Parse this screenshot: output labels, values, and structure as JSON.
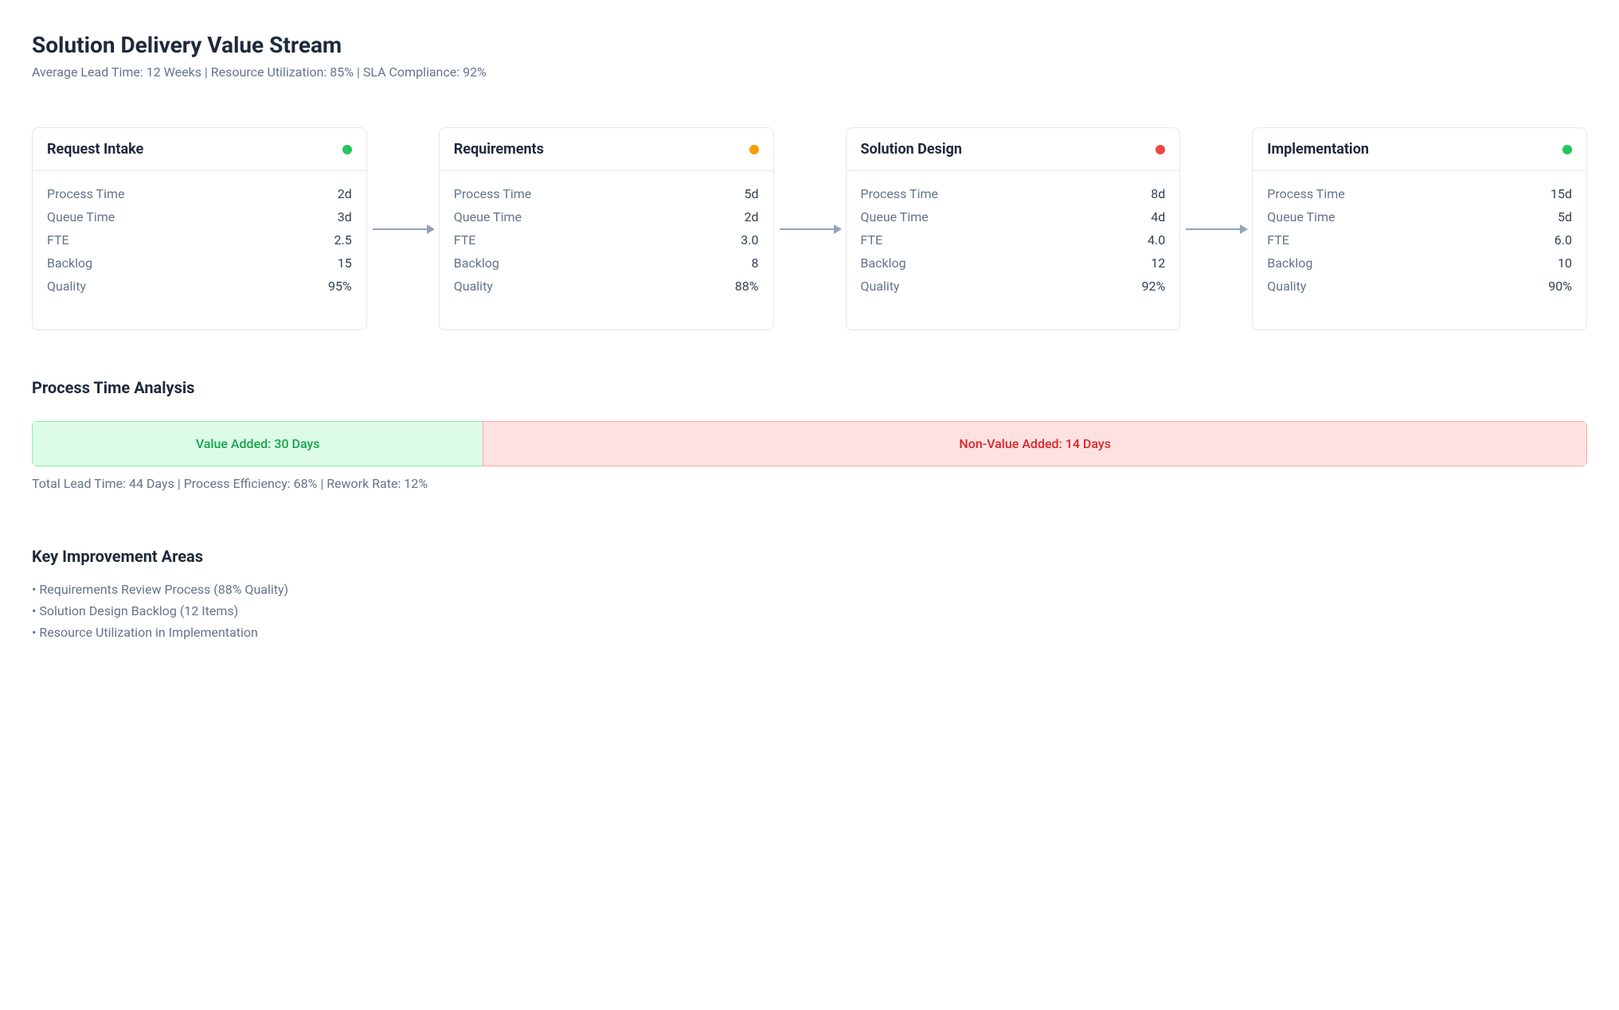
{
  "header": {
    "title": "Solution Delivery Value Stream",
    "sub": "Average Lead Time: 12 Weeks | Resource Utilization: 85% | SLA Compliance: 92%"
  },
  "labels": {
    "process_time": "Process Time",
    "queue_time": "Queue Time",
    "fte": "FTE",
    "backlog": "Backlog",
    "quality": "Quality"
  },
  "colors": {
    "green": "#22c55e",
    "amber": "#f59e0b",
    "red": "#ef4444"
  },
  "stages": [
    {
      "title": "Request Intake",
      "status": "green",
      "process_time": "2d",
      "queue_time": "3d",
      "fte": "2.5",
      "backlog": "15",
      "quality": "95%"
    },
    {
      "title": "Requirements",
      "status": "amber",
      "process_time": "5d",
      "queue_time": "2d",
      "fte": "3.0",
      "backlog": "8",
      "quality": "88%"
    },
    {
      "title": "Solution Design",
      "status": "red",
      "process_time": "8d",
      "queue_time": "4d",
      "fte": "4.0",
      "backlog": "12",
      "quality": "92%"
    },
    {
      "title": "Implementation",
      "status": "green",
      "process_time": "15d",
      "queue_time": "5d",
      "fte": "6.0",
      "backlog": "10",
      "quality": "90%"
    }
  ],
  "analysis": {
    "title": "Process Time Analysis",
    "value_added_label": "Value Added: 30 Days",
    "non_value_added_label": "Non-Value Added: 14 Days",
    "value_added_days": 30,
    "total_days": 44,
    "summary": "Total Lead Time: 44 Days | Process Efficiency: 68% | Rework Rate: 12%"
  },
  "improvements": {
    "title": "Key Improvement Areas",
    "items": [
      "Requirements Review Process (88% Quality)",
      "Solution Design Backlog (12 Items)",
      "Resource Utilization in Implementation"
    ]
  }
}
